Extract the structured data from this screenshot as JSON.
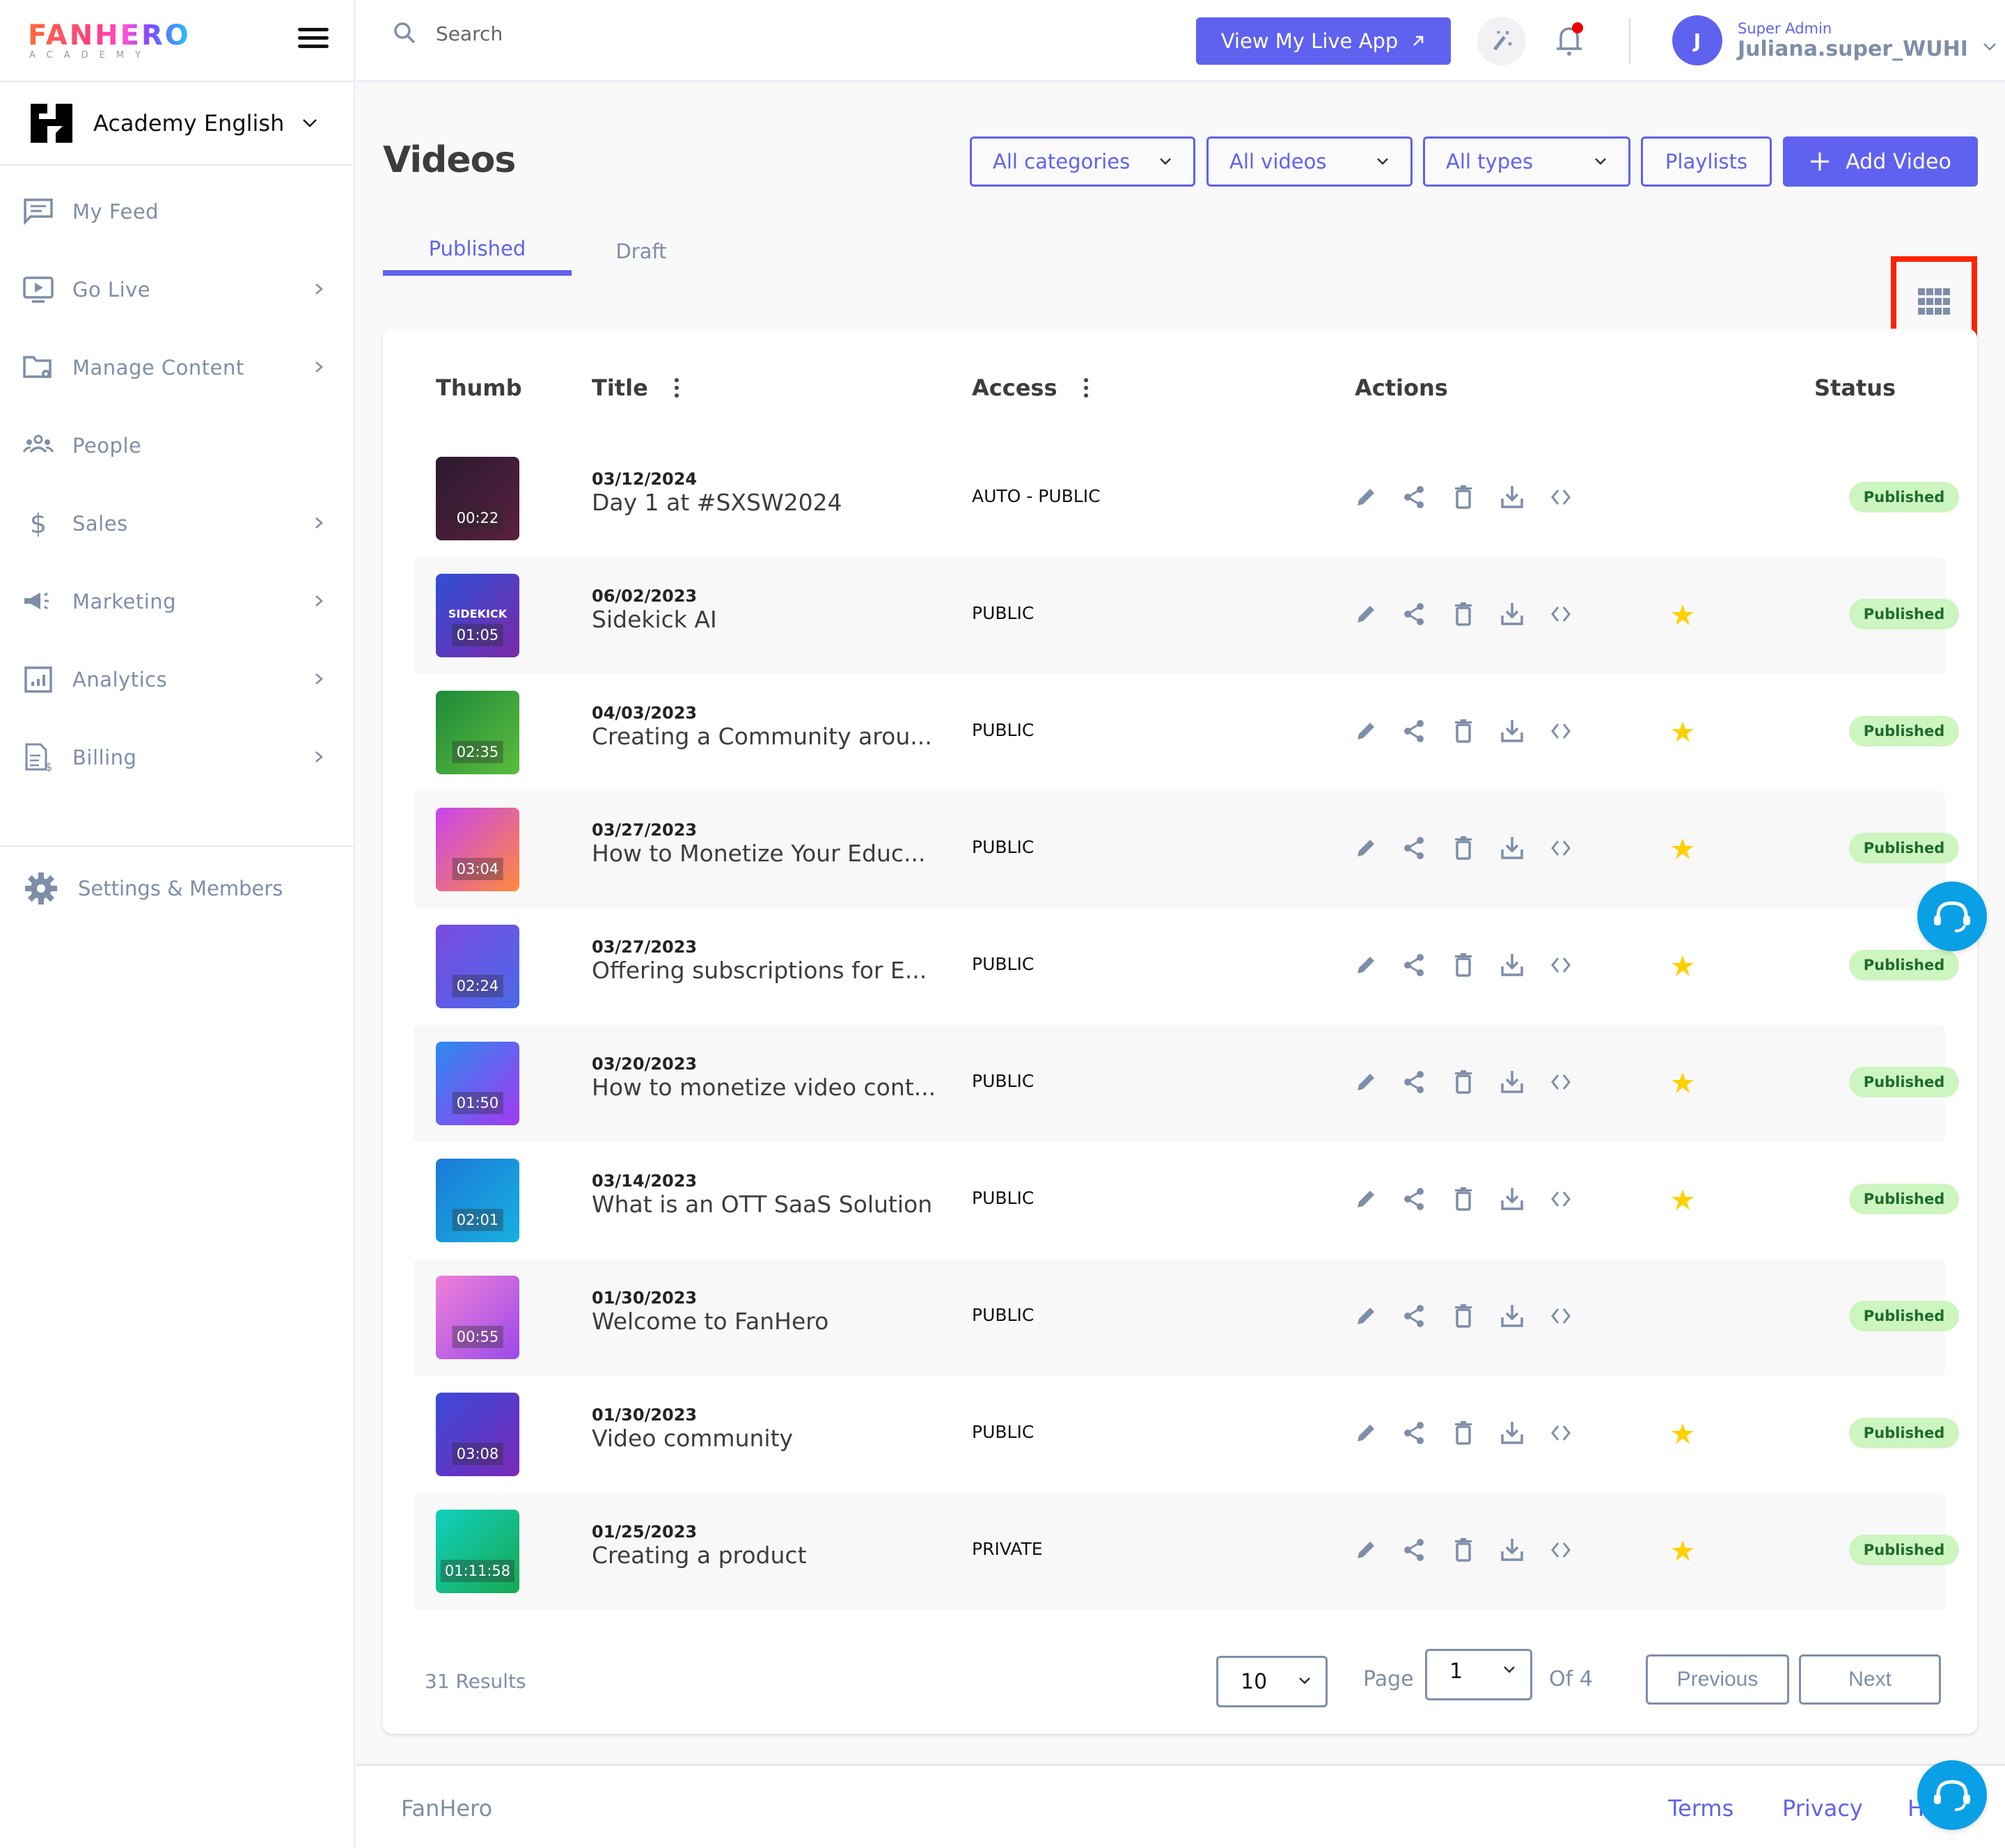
{
  "brand": {
    "logo_word": "FANHERO",
    "logo_sub": "ACADEMY"
  },
  "org": {
    "name": "Academy English"
  },
  "sidebar": {
    "items": [
      {
        "label": "My Feed",
        "icon": "feed-icon",
        "has_children": false
      },
      {
        "label": "Go Live",
        "icon": "live-tv-icon",
        "has_children": true
      },
      {
        "label": "Manage Content",
        "icon": "folder-settings-icon",
        "has_children": true
      },
      {
        "label": "People",
        "icon": "people-icon",
        "has_children": false
      },
      {
        "label": "Sales",
        "icon": "dollar-icon",
        "has_children": true
      },
      {
        "label": "Marketing",
        "icon": "megaphone-icon",
        "has_children": true
      },
      {
        "label": "Analytics",
        "icon": "analytics-icon",
        "has_children": true
      },
      {
        "label": "Billing",
        "icon": "billing-icon",
        "has_children": true
      }
    ],
    "settings_label": "Settings & Members"
  },
  "topbar": {
    "search_placeholder": "Search",
    "live_app_label": "View My Live App",
    "user_role": "Super Admin",
    "user_name": "Juliana.super_WUHI",
    "avatar_initial": "J",
    "has_notification": true
  },
  "page": {
    "title": "Videos",
    "filters": {
      "categories": "All categories",
      "videos": "All videos",
      "types": "All types"
    },
    "playlists_label": "Playlists",
    "add_video_label": "Add Video",
    "tabs": [
      {
        "label": "Published",
        "active": true
      },
      {
        "label": "Draft",
        "active": false
      }
    ]
  },
  "table": {
    "headers": {
      "thumb": "Thumb",
      "title": "Title",
      "access": "Access",
      "actions": "Actions",
      "status": "Status"
    },
    "rows": [
      {
        "duration": "00:22",
        "date": "03/12/2024",
        "title": "Day 1 at #SXSW2024",
        "access": "AUTO - PUBLIC",
        "featured": false,
        "status": "Published",
        "thumb_colors": [
          "#2a1a2e",
          "#5a2040"
        ]
      },
      {
        "duration": "01:05",
        "date": "06/02/2023",
        "title": "Sidekick AI",
        "access": "PUBLIC",
        "featured": true,
        "status": "Published",
        "thumb_label": "SIDEKICK",
        "thumb_colors": [
          "#2f4fd6",
          "#7a2aa8"
        ]
      },
      {
        "duration": "02:35",
        "date": "04/03/2023",
        "title": "Creating a Community arou...",
        "access": "PUBLIC",
        "featured": true,
        "status": "Published",
        "thumb_colors": [
          "#1f8a3a",
          "#5cbc3c"
        ]
      },
      {
        "duration": "03:04",
        "date": "03/27/2023",
        "title": "How to Monetize Your Educ...",
        "access": "PUBLIC",
        "featured": true,
        "status": "Published",
        "thumb_colors": [
          "#c844f0",
          "#ff8a3c"
        ]
      },
      {
        "duration": "02:24",
        "date": "03/27/2023",
        "title": "Offering subscriptions for E...",
        "access": "PUBLIC",
        "featured": true,
        "status": "Published",
        "thumb_colors": [
          "#7a4ae0",
          "#4a6ae8"
        ]
      },
      {
        "duration": "01:50",
        "date": "03/20/2023",
        "title": "How to monetize video cont...",
        "access": "PUBLIC",
        "featured": true,
        "status": "Published",
        "thumb_colors": [
          "#2a8af0",
          "#a33af0"
        ]
      },
      {
        "duration": "02:01",
        "date": "03/14/2023",
        "title": "What is an OTT SaaS Solution",
        "access": "PUBLIC",
        "featured": true,
        "status": "Published",
        "thumb_colors": [
          "#1a7ad8",
          "#18b0e0"
        ]
      },
      {
        "duration": "00:55",
        "date": "01/30/2023",
        "title": "Welcome to FanHero",
        "access": "PUBLIC",
        "featured": false,
        "status": "Published",
        "thumb_colors": [
          "#f080d8",
          "#9a4ae8"
        ]
      },
      {
        "duration": "03:08",
        "date": "01/30/2023",
        "title": "Video community",
        "access": "PUBLIC",
        "featured": true,
        "status": "Published",
        "thumb_colors": [
          "#3a4ad8",
          "#7a2ab8"
        ]
      },
      {
        "duration": "01:11:58",
        "date": "01/25/2023",
        "title": "Creating a product",
        "access": "PRIVATE",
        "featured": true,
        "status": "Published",
        "thumb_colors": [
          "#10d0c0",
          "#18a850"
        ]
      }
    ]
  },
  "pagination": {
    "results": "31 Results",
    "page_size": "10",
    "page_label": "Page",
    "current_page": "1",
    "of_label": "Of  4",
    "previous_label": "Previous",
    "next_label": "Next"
  },
  "footer": {
    "brand": "FanHero",
    "links": [
      "Terms",
      "Privacy",
      "H"
    ]
  },
  "colors": {
    "accent": "#5f62ef",
    "muted": "#7e8ea9",
    "status_bg": "#cdf5c0",
    "status_fg": "#1e6b2c",
    "star": "#ffd000",
    "support": "#0aa0e6",
    "highlight": "#ff2200"
  }
}
